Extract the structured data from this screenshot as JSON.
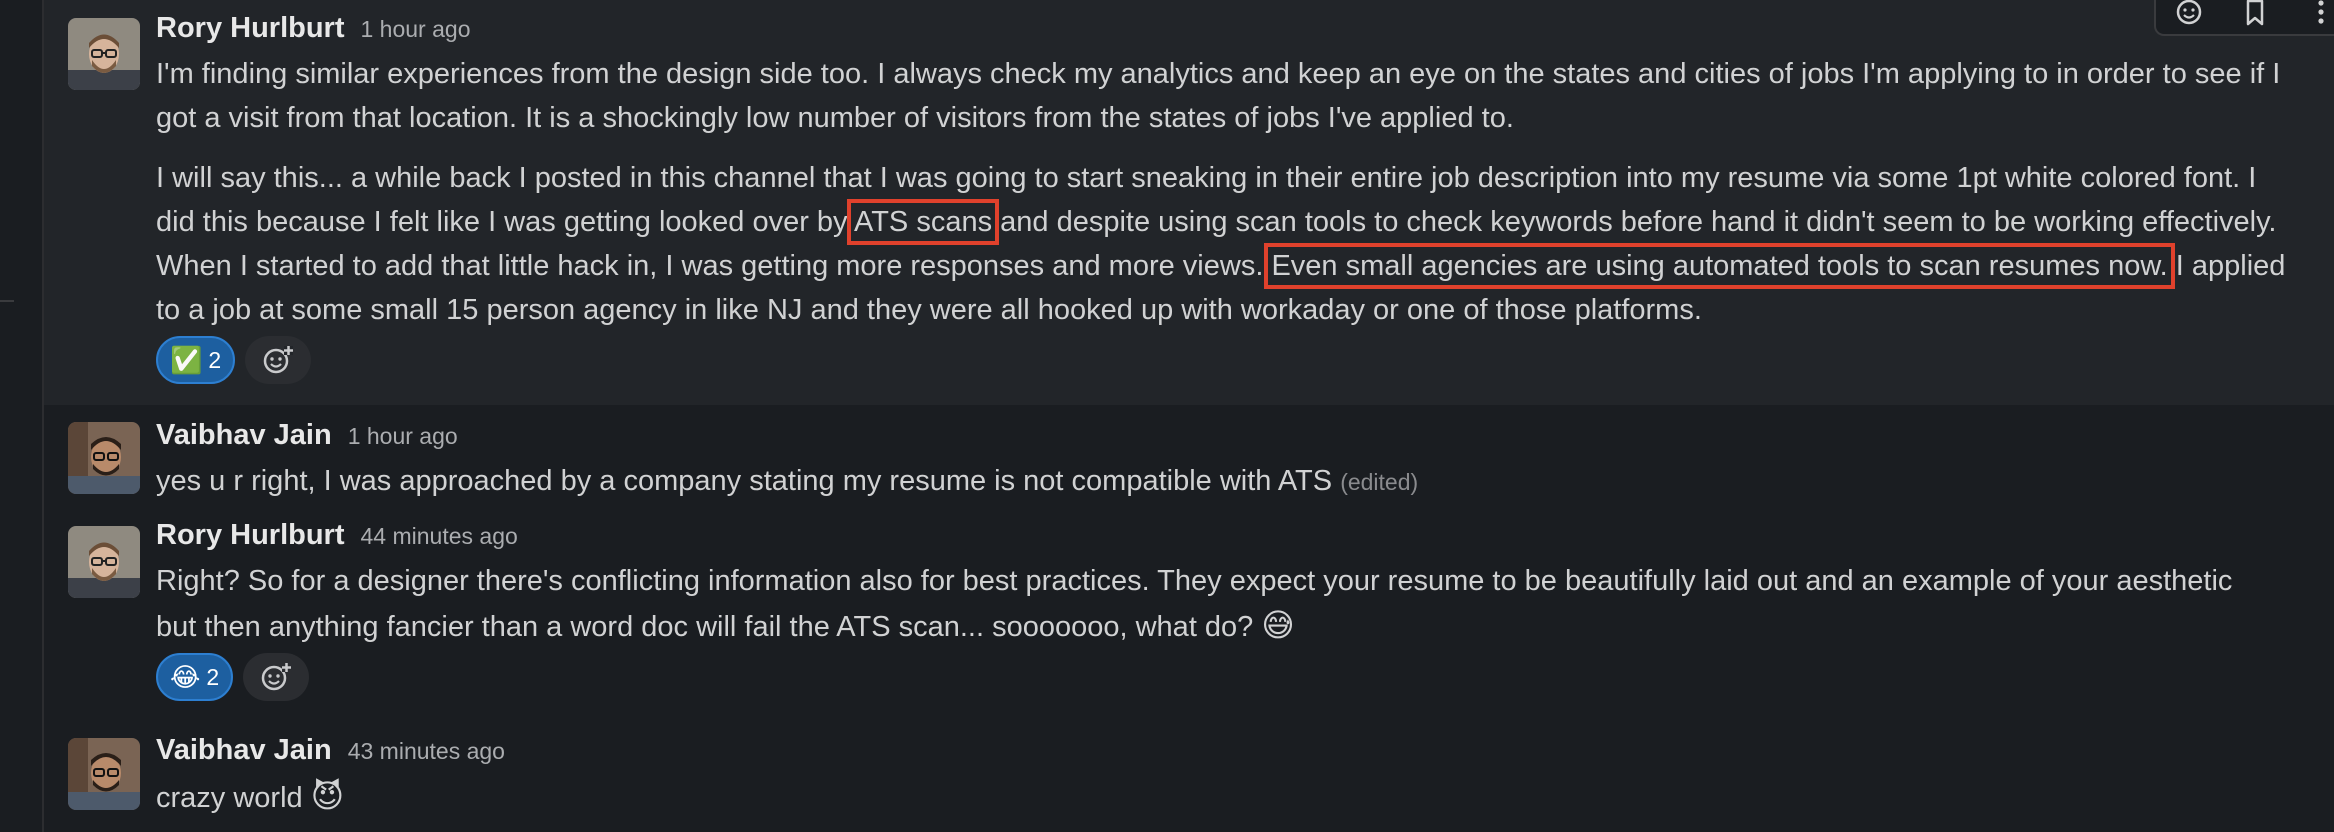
{
  "messages": [
    {
      "author": "Rory Hurlburt",
      "time": "1 hour ago",
      "para1": [
        "I'm finding similar experiences from the design side too. I always check my analytics and keep an eye on the states and cities of jobs I'm applying to in order to see if I",
        "got a visit from that location. It is a shockingly low number of visitors from the states of jobs I've applied to."
      ],
      "para2": {
        "line1": "I will say this... a while back I posted in this channel that I was going to start sneaking in their entire job description into my resume via some 1pt white colored font. I",
        "line2_a": "did this because I felt like I was getting looked over by ",
        "line2_hl": "ATS scans",
        "line2_b": " and despite using scan tools to check keywords before hand it didn't seem to be working effectively.",
        "line3_a": "When I started to add that little hack in, I was getting more responses and more views. ",
        "line3_hl": "Even small agencies are using automated tools to scan resumes now.",
        "line3_b": " I applied",
        "line4": "to a job at some small 15 person agency in like NJ and they were all hooked up with workaday or one of those platforms."
      },
      "reaction": {
        "emoji": "✅",
        "count": "2"
      }
    },
    {
      "author": "Vaibhav Jain",
      "time": "1 hour ago",
      "text": "yes u r right, I was approached by a company stating my resume is not compatible with ATS",
      "edited": "(edited)"
    },
    {
      "author": "Rory Hurlburt",
      "time": "44 minutes ago",
      "line1": "Right? So for a designer there's conflicting information also for best practices. They expect your resume to be beautifully laid out and an example of your aesthetic",
      "line2": "but then anything fancier than a word doc will fail the ATS scan... sooooooo, what do?",
      "emoji": "😅",
      "reaction": {
        "emoji": "😂",
        "count": "2"
      }
    },
    {
      "author": "Vaibhav Jain",
      "time": "43 minutes ago",
      "text": "crazy world",
      "emoji": "😈"
    }
  ],
  "toolbar": {
    "icons": [
      "add-reaction-icon",
      "bookmark-icon",
      "more-actions-icon"
    ]
  },
  "colors": {
    "background": "#1a1d21",
    "highlight_row": "#222529",
    "annotation_box": "#e0412c",
    "reaction_pill": "#1d5fa0"
  }
}
